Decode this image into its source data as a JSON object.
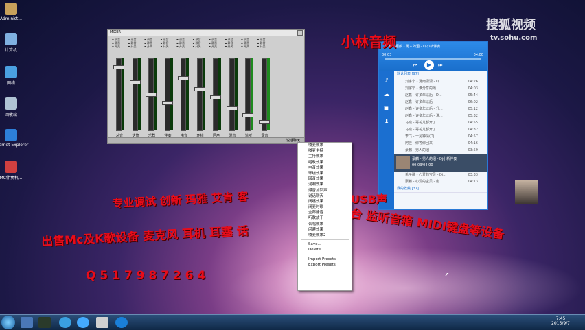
{
  "desktop_icons": [
    {
      "label": "Administ...",
      "color": "#c8a15b"
    },
    {
      "label": "计算机",
      "color": "#7fb0e0"
    },
    {
      "label": "网络",
      "color": "#4aa0e0"
    },
    {
      "label": "回收站",
      "color": "#b0c4d4"
    },
    {
      "label": "Internet Explorer",
      "color": "#2d7fd8"
    },
    {
      "label": "MC伴奏机...",
      "color": "#d04040"
    }
  ],
  "watermark": {
    "site": "搜狐视频",
    "url": "tv.sohu.com"
  },
  "mixer": {
    "title": "MIXER",
    "channels": [
      "总音",
      "话筒",
      "乐器",
      "伴奏",
      "电音",
      "环绕",
      "回声",
      "混音",
      "监听",
      "录音"
    ],
    "footer": "说话聊天"
  },
  "context_menu": {
    "items": [
      "喊麦效果",
      "喊麦主持",
      "主持效果",
      "唱歌效果",
      "电音效果",
      "环绕效果",
      "回音效果",
      "混响效果",
      "爆音加回声",
      "说话聊天",
      "闭嘴效果",
      "闭麦时歌",
      "全部静音",
      "听歌放干",
      "合唱效果",
      "闪避效果",
      "喊麦效果2"
    ],
    "actions": [
      "Save...",
      "Delete"
    ],
    "presets": [
      "Import Presets",
      "Export Presets"
    ]
  },
  "player": {
    "tab": "标准",
    "now_title": "豪麟 - 男人的泪 - Dj小新伴奏",
    "time_start": "00:03",
    "time_end": "04:00",
    "playlist_header": "默认列表 [97]",
    "rows": [
      {
        "title": "刘宇宁 - 夏雨潇潇 - Dj...",
        "time": "04:26"
      },
      {
        "title": "刘宇宁 - 谁分享的她",
        "time": "04:03"
      },
      {
        "title": "赵鑫 - 许多年以后 - D...",
        "time": "05:44"
      },
      {
        "title": "赵鑫 - 许多年以后",
        "time": "06:02"
      },
      {
        "title": "赵鑫 - 许多年以后 - 升...",
        "time": "05:12"
      },
      {
        "title": "赵鑫 - 许多年以后 - 沸...",
        "time": "05:32"
      },
      {
        "title": "马晓 - 哥花儿都开了",
        "time": "04:55"
      },
      {
        "title": "马晓 - 哥花儿都开了",
        "time": "04:32"
      },
      {
        "title": "李飞 - 一见钟情(Dj...",
        "time": "04:57"
      },
      {
        "title": "阿佳 - 你等你回来",
        "time": "04:16"
      },
      {
        "title": "豪麟 - 男人的泪",
        "time": "03:59"
      }
    ],
    "playing_title": "豪麟 - 男人的泪 - Dj小新伴奏",
    "playing_time": "00:03/04:00",
    "rows_after": [
      {
        "title": "希子歌 - 心爱的宝贝 - Dj...",
        "time": "03:33"
      },
      {
        "title": "豪麟 - 心爱的宝贝 - 唐",
        "time": "04:13"
      }
    ],
    "footer_list": "我的收藏 [37]"
  },
  "overlay": {
    "title": "小林音频",
    "line1": "专业调试 创新 玛雅 艾肯 客",
    "line1b": "USB声",
    "line2": "出售Mc及K歌设备 麦克风 耳机 耳塞 话",
    "line2b": "台 监听音箱 MIDI键盘等设备",
    "qq": "Q 5 1 7 9 8 7 2 6 4"
  },
  "taskbar": {
    "time": "7:45",
    "date": "2015/9/7",
    "apps": [
      "start",
      "qq",
      "media",
      "ie",
      "qqmusic",
      "kugou",
      "k"
    ]
  }
}
